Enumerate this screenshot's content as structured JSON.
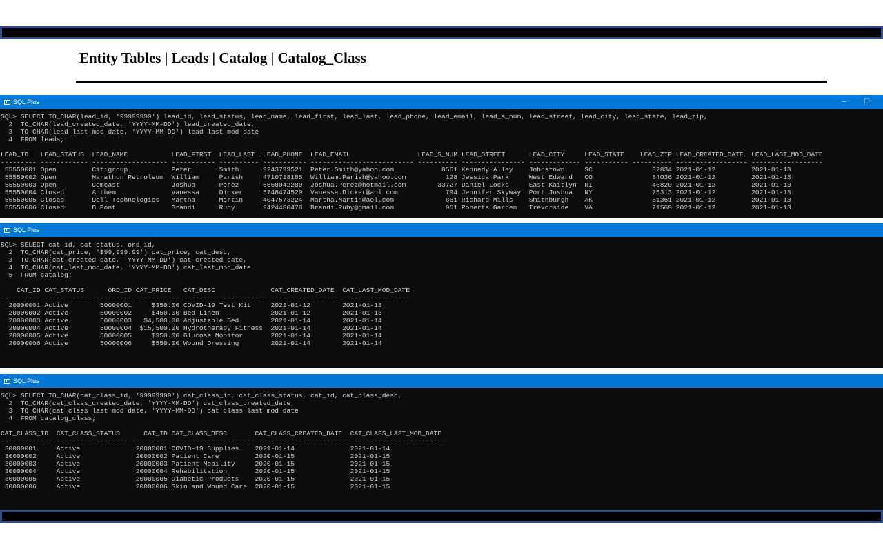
{
  "slide": {
    "title": "Entity  Tables | Leads | Catalog | Catalog_Class"
  },
  "windows": [
    {
      "title": "SQL Plus",
      "lines": [
        "SQL> SELECT TO_CHAR(lead_id, '99999999') lead_id, lead_status, lead_name, lead_first, lead_last, lead_phone, lead_email, lead_s_num, lead_street, lead_city, lead_state, lead_zip,",
        "  2  TO_CHAR(lead_created_date, 'YYYY-MM-DD') lead_created_date,",
        "  3  TO_CHAR(lead_last_mod_date, 'YYYY-MM-DD') lead_last_mod_date",
        "  4  FROM leads;",
        "",
        "LEAD_ID   LEAD_STATUS  LEAD_NAME           LEAD_FIRST  LEAD_LAST  LEAD_PHONE  LEAD_EMAIL                 LEAD_S_NUM LEAD_STREET      LEAD_CITY     LEAD_STATE    LEAD_ZIP LEAD_CREATED_DATE  LEAD_LAST_MOD_DATE",
        "--------- ------------ ------------------- ----------- ---------- ----------- -------------------------- ---------- ---------------- ------------- ----------- ---------- ------------------ ------------------",
        " 55550001 Open         Citigroup           Peter       Smith      9243799521  Peter.Smith@yahoo.com            8561 Kennedy Alley    Johnstown     SC               82834 2021-01-12         2021-01-13",
        " 55550002 Open         Marathon Petroleum  William     Parish     4710718185  William.Parish@yahoo.com          128 Jessica Park     West Edward   CO               84036 2021-01-12         2021-01-13",
        " 55550003 Open         Comcast             Joshua      Perez      5668042289  Joshua.Perez@hotmail.com        33727 Daniel Locks     East Kaitlyn  RI               46820 2021-01-12         2021-01-13",
        " 55550004 Closed       Anthem              Vanessa     Dicker     5748474529  Vanessa.Dicker@aol.com            794 Jennifer Skyway  Port Joshua   NY               75313 2021-01-12         2021-01-13",
        " 55550005 Closed       Dell Technologies   Martha      Martin     4047573224  Martha.Martin@aol.com             861 Richard Mills    Smithburgh    AK               51361 2021-01-12         2021-01-13",
        " 55550006 Closed       DuPont              Brandi      Ruby       9424480478  Brandi.Ruby@gmail.com             961 Roberts Garden   Trevorside    VA               71569 2021-01-12         2021-01-13"
      ]
    },
    {
      "title": "SQL Plus",
      "lines": [
        "SQL> SELECT cat_id, cat_status, ord_id,",
        "  2  TO_CHAR(cat_price, '$99,999.99') cat_price, cat_desc,",
        "  3  TO_CHAR(cat_created_date, 'YYYY-MM-DD') cat_created_date,",
        "  4  TO_CHAR(cat_last_mod_date, 'YYYY-MM-DD') cat_last_mod_date",
        "  5  FROM catalog;",
        "",
        "    CAT_ID CAT_STATUS      ORD_ID CAT_PRICE   CAT_DESC              CAT_CREATED_DATE  CAT_LAST_MOD_DATE",
        "---------- ----------- ---------- ----------- --------------------- ----------------- -----------------",
        "  20000001 Active        50000001     $350.00 COVID-19 Test Kit     2021-01-12        2021-01-13",
        "  20000002 Active        50000002     $450.00 Bed Linen             2021-01-12        2021-01-13",
        "  20000003 Active        50000003   $4,500.00 Adjustable Bed        2021-01-14        2021-01-14",
        "  20000004 Active        50000004  $15,500.00 Hydrotherapy Fitness  2021-01-14        2021-01-14",
        "  20000005 Active        50000005     $950.00 Glucose Monitor       2021-01-14        2021-01-14",
        "  20000006 Active        50000006     $550.00 Wound Dressing        2021-01-14        2021-01-14"
      ]
    },
    {
      "title": "SQL Plus",
      "lines": [
        "SQL> SELECT TO_CHAR(cat_class_id, '99999999') cat_class_id, cat_class_status, cat_id, cat_class_desc,",
        "  2  TO_CHAR(cat_class_created_date, 'YYYY-MM-DD') cat_class_created_date,",
        "  3  TO_CHAR(cat_class_last_mod_date, 'YYYY-MM-DD') cat_class_last_mod_date",
        "  4  FROM catalog_class;",
        "",
        "CAT_CLASS_ID  CAT_CLASS_STATUS      CAT_ID CAT_CLASS_DESC       CAT_CLASS_CREATED_DATE  CAT_CLASS_LAST_MOD_DATE",
        "------------- ------------------ ---------- -------------------- ----------------------- -----------------------",
        " 30000001     Active              20000001 COVID-19 Supplies    2021-01-14              2021-01-14",
        " 30000002     Active              20000002 Patient Care         2020-01-15              2021-01-15",
        " 30000003     Active              20000003 Patient Mobility     2020-01-15              2021-01-15",
        " 30000004     Active              20000004 Rehabilitation       2020-01-15              2021-01-15",
        " 30000005     Active              20000005 Diabetic Products    2020-01-15              2021-01-15",
        " 30000006     Active              20000006 Skin and Wound Care  2020-01-15              2021-01-15"
      ]
    }
  ],
  "window_controls": {
    "minimize": "–",
    "maximize": "☐"
  }
}
